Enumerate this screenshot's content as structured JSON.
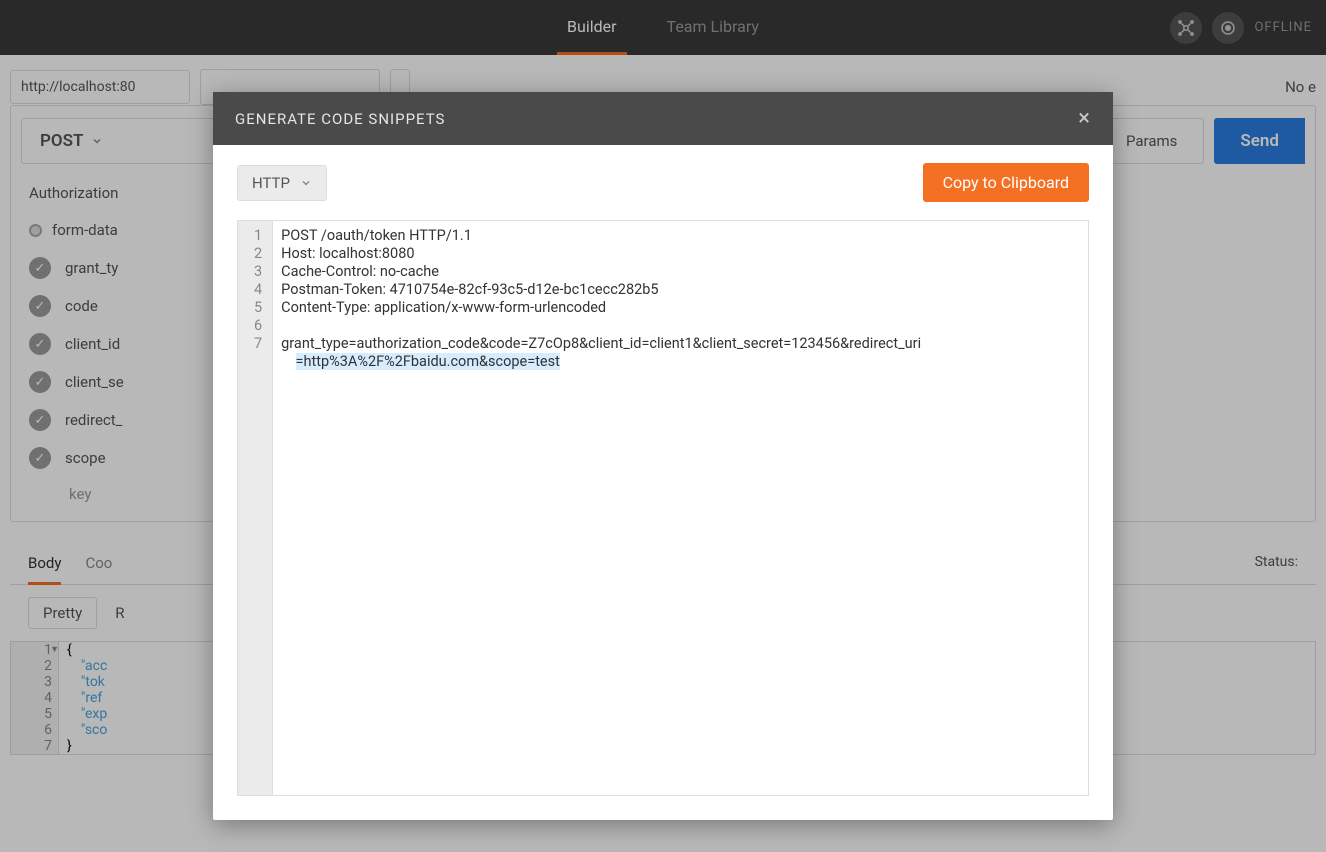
{
  "nav": {
    "tabs": [
      "Builder",
      "Team Library"
    ],
    "active": 0,
    "offline": "OFFLINE"
  },
  "request": {
    "url_preview": "http://localhost:80",
    "no_env": "No e",
    "method": "POST",
    "params_btn": "Params",
    "send_btn": "Send",
    "auth_tab": "Authorization",
    "bodytype": "form-data",
    "params": [
      "grant_ty",
      "code",
      "client_id",
      "client_se",
      "redirect_",
      "scope"
    ],
    "key_placeholder": "key"
  },
  "response": {
    "tabs": [
      "Body",
      "Coo"
    ],
    "status_label": "Status:",
    "pretty": "Pretty",
    "r": "R",
    "json_lines": [
      {
        "n": "1",
        "text": "{",
        "arrow": true
      },
      {
        "n": "2",
        "key": "\"acc"
      },
      {
        "n": "3",
        "key": "\"tok"
      },
      {
        "n": "4",
        "key": "\"ref"
      },
      {
        "n": "5",
        "key": "\"exp"
      },
      {
        "n": "6",
        "key": "\"sco"
      },
      {
        "n": "7",
        "text": "}"
      }
    ]
  },
  "modal": {
    "title": "GENERATE CODE SNIPPETS",
    "lang": "HTTP",
    "copy": "Copy to Clipboard",
    "gutter": [
      "1",
      "2",
      "3",
      "4",
      "5",
      "6",
      "7"
    ],
    "code_lines": [
      "POST /oauth/token HTTP/1.1",
      "Host: localhost:8080",
      "Cache-Control: no-cache",
      "Postman-Token: 4710754e-82cf-93c5-d12e-bc1cecc282b5",
      "Content-Type: application/x-www-form-urlencoded",
      "",
      "grant_type=authorization_code&code=Z7cOp8&client_id=client1&client_secret=123456&redirect_uri"
    ],
    "code_wrap": "=http%3A%2F%2Fbaidu.com&scope=test"
  }
}
